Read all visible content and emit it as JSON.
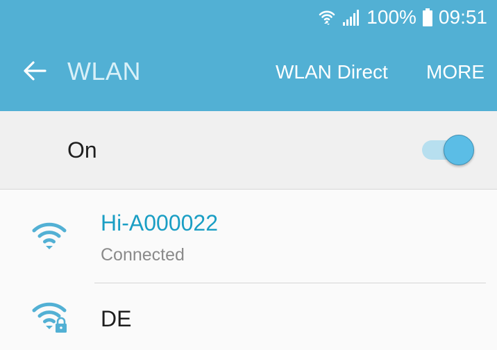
{
  "status_bar": {
    "battery": "100%",
    "time": "09:51",
    "icons": [
      "wifi-icon",
      "signal-icon",
      "battery-icon"
    ]
  },
  "app_bar": {
    "back_icon": "arrow-back-icon",
    "title": "WLAN",
    "actions": {
      "wlan_direct": "WLAN Direct",
      "more": "MORE"
    }
  },
  "master_switch": {
    "label": "On",
    "enabled": true
  },
  "networks": [
    {
      "name": "Hi-A000022",
      "status": "Connected",
      "icon": "wifi-icon",
      "secured": false
    },
    {
      "name": "DE",
      "status": "",
      "icon": "wifi-lock-icon",
      "secured": true
    }
  ],
  "colors": {
    "app_bar": "#52b0d4",
    "accent": "#1a9ec4",
    "switch_thumb": "#5bbde6",
    "switch_track": "#b7dfef"
  }
}
